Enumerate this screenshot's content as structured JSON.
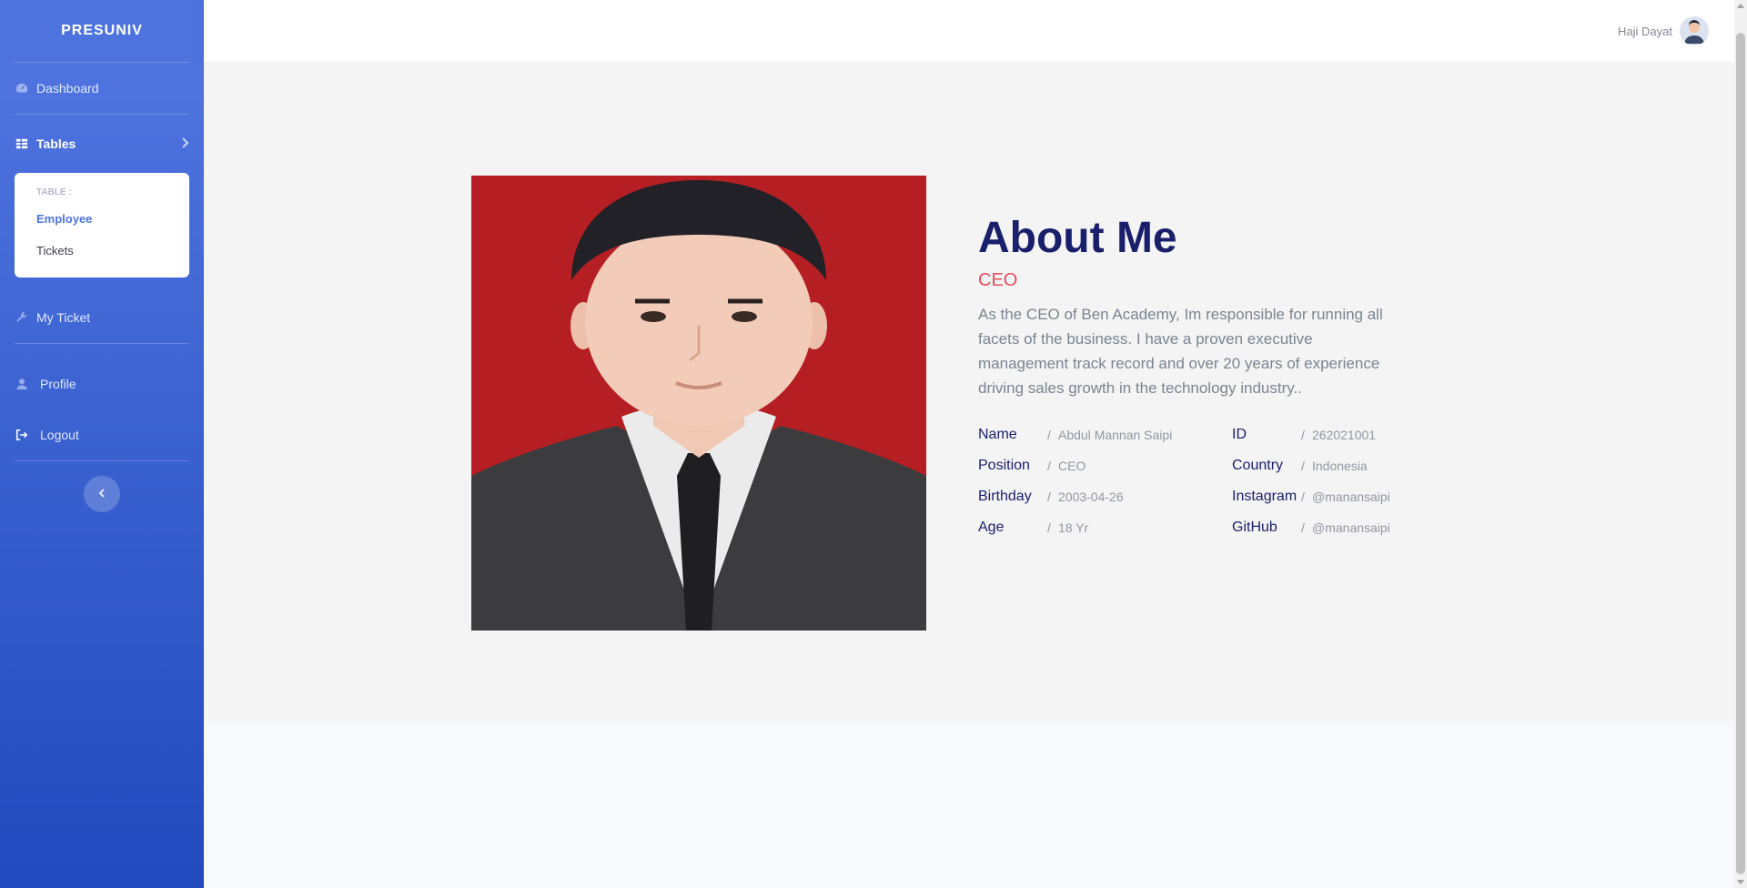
{
  "sidebar": {
    "brand": "PRESUNIV",
    "items": [
      {
        "label": "Dashboard",
        "icon": "tachometer-icon"
      },
      {
        "label": "Tables",
        "icon": "table-icon"
      },
      {
        "label": "My Ticket",
        "icon": "wrench-icon"
      },
      {
        "label": "Profile",
        "icon": "user-icon"
      },
      {
        "label": "Logout",
        "icon": "sign-out-icon"
      }
    ],
    "tables_submenu": {
      "header": "TABLE :",
      "items": [
        "Employee",
        "Tickets"
      ]
    }
  },
  "topbar": {
    "user_name": "Haji Dayat"
  },
  "about": {
    "title": "About Me",
    "role": "CEO",
    "description": "As the CEO of Ben Academy, Im responsible for running all facets of the business. I have a proven executive management track record and over 20 years of experience driving sales growth in the technology industry..",
    "details": [
      {
        "label": "Name",
        "value": "Abdul Mannan Saipi"
      },
      {
        "label": "ID",
        "value": "262021001"
      },
      {
        "label": "Position",
        "value": "CEO"
      },
      {
        "label": "Country",
        "value": "Indonesia"
      },
      {
        "label": "Birthday",
        "value": "2003-04-26"
      },
      {
        "label": "Instagram",
        "value": "@manansaipi"
      },
      {
        "label": "Age",
        "value": "18 Yr"
      },
      {
        "label": "GitHub",
        "value": "@manansaipi"
      }
    ],
    "separator": "/"
  },
  "colors": {
    "sidebar_start": "#4e73df",
    "sidebar_end": "#224abe",
    "title": "#1a1f6b",
    "role": "#e54c5b",
    "photo_bg": "#b51f23"
  }
}
